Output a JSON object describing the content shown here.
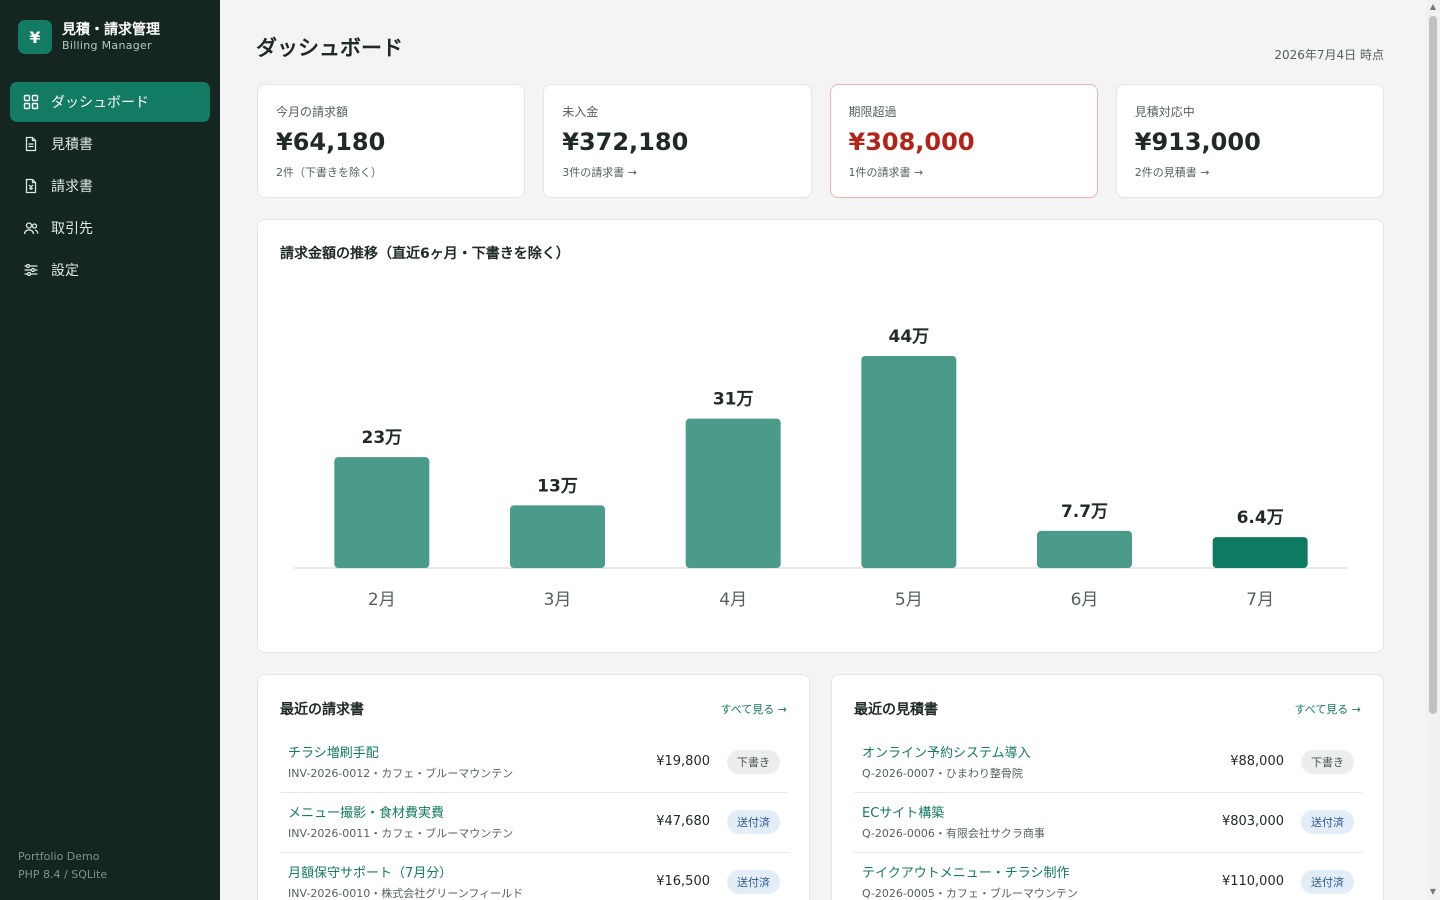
{
  "brand": {
    "logo": "¥",
    "title": "見積・請求管理",
    "subtitle": "Billing Manager"
  },
  "nav": [
    {
      "label": "ダッシュボード",
      "icon": "dashboard-icon",
      "active": true
    },
    {
      "label": "見積書",
      "icon": "document-icon",
      "active": false
    },
    {
      "label": "請求書",
      "icon": "invoice-icon",
      "active": false
    },
    {
      "label": "取引先",
      "icon": "users-icon",
      "active": false
    },
    {
      "label": "設定",
      "icon": "sliders-icon",
      "active": false
    }
  ],
  "footer": {
    "line1": "Portfolio Demo",
    "line2": "PHP 8.4 / SQLite"
  },
  "header": {
    "title": "ダッシュボード",
    "as_of": "2026年7月4日 時点"
  },
  "kpis": [
    {
      "label": "今月の請求額",
      "value": "¥64,180",
      "note": "2件（下書きを除く）"
    },
    {
      "label": "未入金",
      "value": "¥372,180",
      "note": "3件の請求書 →"
    },
    {
      "label": "期限超過",
      "value": "¥308,000",
      "note": "1件の請求書 →"
    },
    {
      "label": "見積対応中",
      "value": "¥913,000",
      "note": "2件の見積書 →"
    }
  ],
  "chart_title": "請求金額の推移（直近6ヶ月・下書きを除く）",
  "chart_data": {
    "type": "bar",
    "categories": [
      "2月",
      "3月",
      "4月",
      "5月",
      "6月",
      "7月"
    ],
    "values": [
      230000,
      130000,
      310000,
      440000,
      77000,
      64180
    ],
    "data_labels": [
      "23万",
      "13万",
      "31万",
      "44万",
      "7.7万",
      "6.4万"
    ],
    "highlight_index": 5,
    "colors": {
      "bar": "#4a9b8a",
      "highlight": "#0f7a62",
      "axis": "#dde2df"
    }
  },
  "invoices": {
    "title": "最近の請求書",
    "see_all": "すべて見る →",
    "rows": [
      {
        "title": "チラシ増刷手配",
        "sub": "INV-2026-0012・カフェ・ブルーマウンテン",
        "amount": "¥19,800",
        "status": "下書き",
        "kind": "draft"
      },
      {
        "title": "メニュー撮影・食材費実費",
        "sub": "INV-2026-0011・カフェ・ブルーマウンテン",
        "amount": "¥47,680",
        "status": "送付済",
        "kind": "sent"
      },
      {
        "title": "月額保守サポート（7月分）",
        "sub": "INV-2026-0010・株式会社グリーンフィールド",
        "amount": "¥16,500",
        "status": "送付済",
        "kind": "sent"
      }
    ]
  },
  "quotes": {
    "title": "最近の見積書",
    "see_all": "すべて見る →",
    "rows": [
      {
        "title": "オンライン予約システム導入",
        "sub": "Q-2026-0007・ひまわり整骨院",
        "amount": "¥88,000",
        "status": "下書き",
        "kind": "draft"
      },
      {
        "title": "ECサイト構築",
        "sub": "Q-2026-0006・有限会社サクラ商事",
        "amount": "¥803,000",
        "status": "送付済",
        "kind": "sent"
      },
      {
        "title": "テイクアウトメニュー・チラシ制作",
        "sub": "Q-2026-0005・カフェ・ブルーマウンテン",
        "amount": "¥110,000",
        "status": "送付済",
        "kind": "sent"
      }
    ]
  }
}
